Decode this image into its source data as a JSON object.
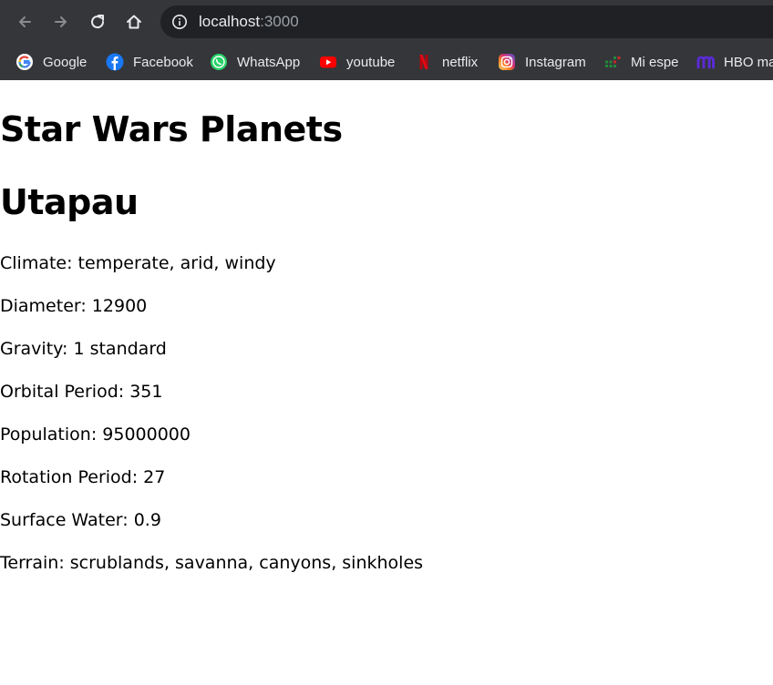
{
  "browser": {
    "url_host": "localhost",
    "url_port": ":3000",
    "bookmarks": [
      {
        "label": "Google",
        "icon": "google-icon"
      },
      {
        "label": "Facebook",
        "icon": "facebook-icon"
      },
      {
        "label": "WhatsApp",
        "icon": "whatsapp-icon"
      },
      {
        "label": "youtube",
        "icon": "youtube-icon"
      },
      {
        "label": "netflix",
        "icon": "netflix-icon"
      },
      {
        "label": "Instagram",
        "icon": "instagram-icon"
      },
      {
        "label": "Mi espe",
        "icon": "mi-espe-icon"
      },
      {
        "label": "HBO ma",
        "icon": "hbo-max-icon"
      }
    ]
  },
  "page": {
    "title": "Star Wars Planets",
    "planet": {
      "name": "Utapau",
      "climate": "Climate: temperate, arid, windy",
      "diameter": "Diameter: 12900",
      "gravity": "Gravity: 1 standard",
      "orbital_period": "Orbital Period: 351",
      "population": "Population: 95000000",
      "rotation_period": "Rotation Period: 27",
      "surface_water": "Surface Water: 0.9",
      "terrain": "Terrain: scrublands, savanna, canyons, sinkholes"
    }
  },
  "colors": {
    "chrome_bg": "#35363a",
    "omnibox_bg": "#202124",
    "chrome_text": "#e8eaed",
    "url_dim": "#9aa0a6"
  }
}
